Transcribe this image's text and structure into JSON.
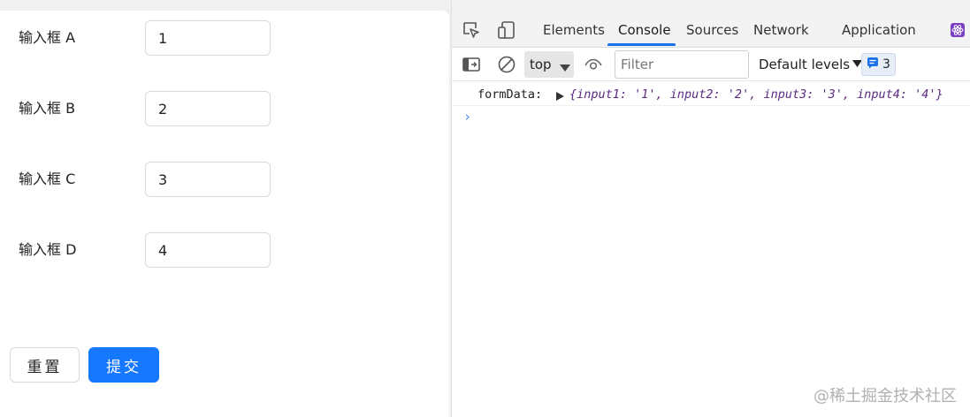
{
  "form": {
    "fields": [
      {
        "label": "输入框 A",
        "value": "1"
      },
      {
        "label": "输入框 B",
        "value": "2"
      },
      {
        "label": "输入框 C",
        "value": "3"
      },
      {
        "label": "输入框 D",
        "value": "4"
      }
    ],
    "reset_label": "重置",
    "submit_label": "提交"
  },
  "devtools": {
    "tabs": [
      "Elements",
      "Console",
      "Sources",
      "Network",
      "Application"
    ],
    "active_tab": "Console",
    "context_value": "top",
    "filter_placeholder": "Filter",
    "levels_label": "Default levels",
    "issues_count": "3",
    "log": {
      "label": "formData:",
      "object_text": "{input1: '1', input2: '2', input3: '3', input4: '4'}"
    },
    "prompt_symbol": "›",
    "accent_color": "#1a73e8"
  },
  "watermark": "@稀土掘金技术社区",
  "colors": {
    "primary_button": "#1677ff",
    "console_object": "#5a2a82"
  },
  "icons": {
    "inspect": "inspect-element-icon",
    "device": "device-toolbar-icon",
    "react": "react-devtools-icon",
    "sidebar": "sidebar-toggle-icon",
    "clear": "clear-console-icon",
    "eye": "live-expression-icon",
    "message": "message-icon"
  }
}
